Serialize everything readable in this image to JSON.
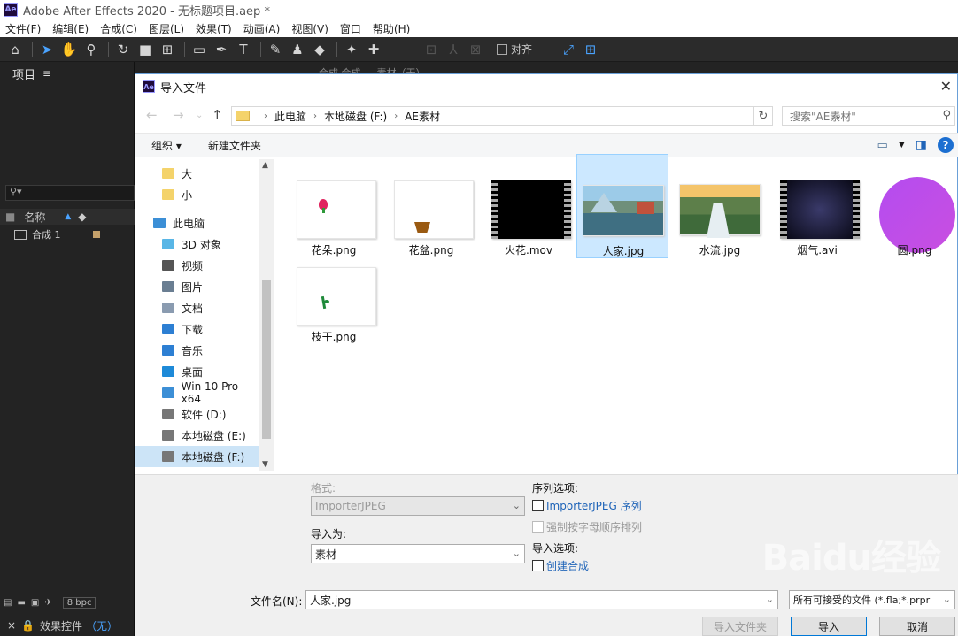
{
  "app": {
    "logo_text": "Ae",
    "title": "Adobe After Effects 2020 - 无标题项目.aep *",
    "menu": [
      "文件(F)",
      "编辑(E)",
      "合成(C)",
      "图层(L)",
      "效果(T)",
      "动画(A)",
      "视图(V)",
      "窗口",
      "帮助(H)"
    ],
    "snap_label": "对齐"
  },
  "project": {
    "title": "项目",
    "col_name": "名称",
    "items": [
      {
        "name": "合成 1"
      }
    ],
    "bpc": "8 bpc",
    "effects_tab": "效果控件",
    "effects_target": "（无）"
  },
  "comp_tabs": "合成 合成  —   素材（无）",
  "dialog": {
    "title": "导入文件",
    "breadcrumb": [
      "此电脑",
      "本地磁盘 (F:)",
      "AE素材"
    ],
    "search_placeholder": "搜索\"AE素材\"",
    "organize_label": "组织 ▾",
    "new_folder_label": "新建文件夹",
    "nav": [
      {
        "label": "大",
        "icon": "folder-icon",
        "color": "#f4d36b"
      },
      {
        "label": "小",
        "icon": "folder-icon",
        "color": "#f4d36b"
      },
      {
        "label": "此电脑",
        "icon": "computer-icon",
        "color": "#3c8fd6"
      },
      {
        "label": "3D 对象",
        "icon": "cube-icon",
        "color": "#59b6e6"
      },
      {
        "label": "视频",
        "icon": "video-icon",
        "color": "#555555"
      },
      {
        "label": "图片",
        "icon": "picture-icon",
        "color": "#6a7e92"
      },
      {
        "label": "文档",
        "icon": "document-icon",
        "color": "#8a9bb0"
      },
      {
        "label": "下载",
        "icon": "download-icon",
        "color": "#2d7fd3"
      },
      {
        "label": "音乐",
        "icon": "music-icon",
        "color": "#2d7fd3"
      },
      {
        "label": "桌面",
        "icon": "desktop-icon",
        "color": "#1e8ad8"
      },
      {
        "label": "Win 10 Pro x64",
        "icon": "windows-drive-icon",
        "color": "#3c8fd6"
      },
      {
        "label": "软件 (D:)",
        "icon": "drive-icon",
        "color": "#777777"
      },
      {
        "label": "本地磁盘 (E:)",
        "icon": "drive-icon",
        "color": "#777777"
      },
      {
        "label": "本地磁盘 (F:)",
        "icon": "drive-icon",
        "color": "#777777",
        "selected": true
      }
    ],
    "files": [
      {
        "name": "花朵.png",
        "kind": "flower"
      },
      {
        "name": "花盆.png",
        "kind": "pot"
      },
      {
        "name": "火花.mov",
        "kind": "film-dark"
      },
      {
        "name": "人家.jpg",
        "kind": "lake",
        "selected": true
      },
      {
        "name": "水流.jpg",
        "kind": "waterfall"
      },
      {
        "name": "烟气.avi",
        "kind": "film-smoke"
      },
      {
        "name": "圆.png",
        "kind": "circle"
      },
      {
        "name": "枝干.png",
        "kind": "stem"
      }
    ],
    "format_label": "格式:",
    "format_value": "ImporterJPEG",
    "import_as_label": "导入为:",
    "import_as_value": "素材",
    "sequence_label": "序列选项:",
    "sequence_option": "ImporterJPEG 序列",
    "force_alpha_option": "强制按字母顺序排列",
    "import_options_label": "导入选项:",
    "create_comp_option": "创建合成",
    "filename_label": "文件名(N):",
    "filename_value": "人家.jpg",
    "filetype_value": "所有可接受的文件 (*.fla;*.prpr",
    "import_folder_btn": "导入文件夹",
    "import_btn": "导入",
    "cancel_btn": "取消"
  },
  "watermark": "Baidu经验"
}
